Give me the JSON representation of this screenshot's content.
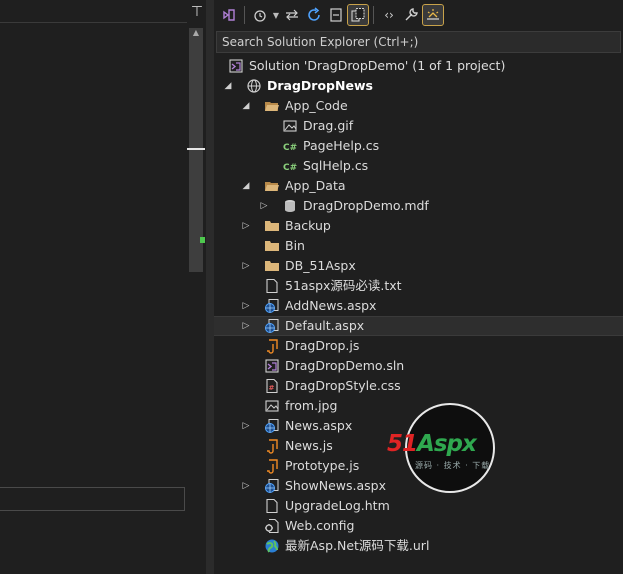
{
  "search": {
    "placeholder": "Search Solution Explorer (Ctrl+;)"
  },
  "solution": {
    "label": "Solution 'DragDropDemo' (1 of 1 project)"
  },
  "project": {
    "label": "DragDropNews"
  },
  "items": {
    "app_code": "App_Code",
    "drag_gif": "Drag.gif",
    "pagehelp": "PageHelp.cs",
    "sqlhelp": "SqlHelp.cs",
    "app_data": "App_Data",
    "mdf": "DragDropDemo.mdf",
    "backup": "Backup",
    "bin": "Bin",
    "db": "DB_51Aspx",
    "readme": "51aspx源码必读.txt",
    "addnews": "AddNews.aspx",
    "default": "Default.aspx",
    "dragdrop_js": "DragDrop.js",
    "sln": "DragDropDemo.sln",
    "css": "DragDropStyle.css",
    "from_jpg": "from.jpg",
    "news_aspx": "News.aspx",
    "news_js": "News.js",
    "prototype": "Prototype.js",
    "shownews": "ShowNews.aspx",
    "upgradelog": "UpgradeLog.htm",
    "webconfig": "Web.config",
    "url": "最新Asp.Net源码下载.url"
  },
  "watermark": {
    "brand_red": "51",
    "brand_green": "Aspx",
    "tagline": "源码 · 技术 · 下载"
  },
  "colors": {
    "accent_purple": "#b180d7",
    "folder": "#dcb67a",
    "csharp": "#8bd17c",
    "js": "#f08a24",
    "web": "#4fa3ff",
    "selected_bg": "#2e2e2e"
  }
}
